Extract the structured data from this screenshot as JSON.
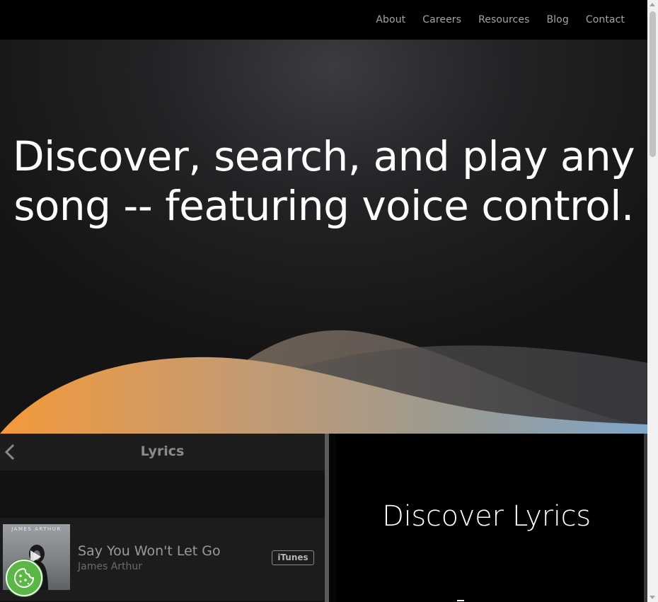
{
  "nav": {
    "items": [
      {
        "label": "About"
      },
      {
        "label": "Careers"
      },
      {
        "label": "Resources"
      },
      {
        "label": "Blog"
      },
      {
        "label": "Contact"
      }
    ]
  },
  "hero": {
    "headline": "Discover, search, and play any song -- featuring voice control."
  },
  "app_mock": {
    "header_title": "Lyrics",
    "back_icon": "chevron-left-icon",
    "song": {
      "album_artist_text": "JAMES ARTHUR",
      "title": "Say You Won't Let Go",
      "artist": "James Arthur",
      "store_button": "iTunes"
    }
  },
  "feature": {
    "title": "Discover Lyrics"
  },
  "cookie_button": {
    "icon": "cookie-icon",
    "color": "#5ab746"
  },
  "colors": {
    "wave_orange": "#f39a3a",
    "wave_blue": "#7fa6c9",
    "background": "#000000"
  }
}
